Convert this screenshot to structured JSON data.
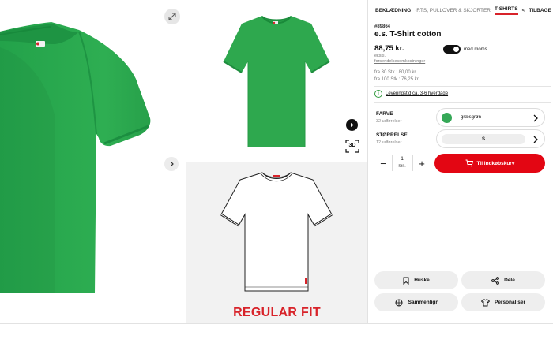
{
  "gallery": {
    "expand_icon": "expand-arrows-icon",
    "next_icon": "chevron-right-icon",
    "play_icon": "play-icon",
    "view_3d_label": "3D",
    "fit_label": "REGULAR FIT",
    "tshirt_color": "#2ea84e",
    "tshirt_stripe_color": "#d8232a"
  },
  "breadcrumbs": [
    {
      "label": "BEKLÆDNING",
      "state": "normal"
    },
    {
      "label": "·RTS, PULLOVER & SKJORTER",
      "state": "dim"
    },
    {
      "label": "T-SHIRTS",
      "state": "active"
    },
    {
      "label": "<",
      "state": "sep"
    },
    {
      "label": "TILBAGE",
      "state": "normal"
    }
  ],
  "product": {
    "sku": "#89864",
    "title": "e.s. T-Shirt cotton",
    "price": "88,75 kr.",
    "vat_toggle_label": "med moms",
    "vat_toggle_on": true,
    "ship_note_1": "ekskl.",
    "ship_note_2": "forsendelsesomkostninger",
    "tier_1": "fra 30 Stk.: 80,00 kr.",
    "tier_2": "fra 100 Stk.: 76,25 kr.",
    "delivery_text": "Leveringstid ca. 3-6 hverdage",
    "accent_color": "#e30613"
  },
  "options": {
    "color_label": "FARVE",
    "color_count": "32 udførelser",
    "color_value": "græsgrøn",
    "color_swatch": "#35a857",
    "size_label": "STØRRELSE",
    "size_count": "12 udførelser",
    "size_value": "S"
  },
  "quantity": {
    "minus": "−",
    "value": "1",
    "unit": "Stk.",
    "plus": "+"
  },
  "cart_button_label": "Til indkøbskurv",
  "actions": {
    "wishlist_label": "Huske",
    "share_label": "Dele",
    "compare_label": "Sammenlign",
    "personalize_label": "Personaliser"
  }
}
